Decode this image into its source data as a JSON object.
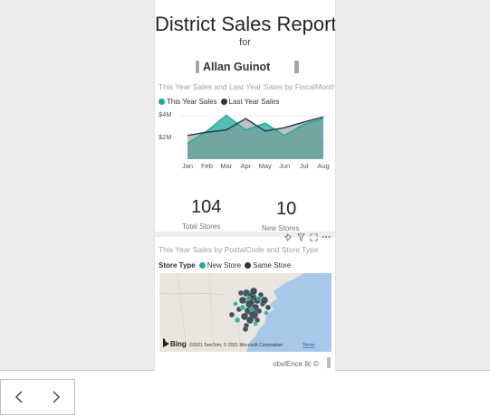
{
  "report": {
    "title": "District Sales Report",
    "subtitle": "for",
    "slicer_value": "Allan Guinot"
  },
  "line_chart": {
    "title": "This Year Sales and Last Year Sales by FiscalMonth",
    "legend": [
      {
        "label": "This Year Sales",
        "color": "#1aab9b"
      },
      {
        "label": "Last Year Sales",
        "color": "#253746"
      }
    ]
  },
  "chart_data": {
    "type": "area",
    "title": "This Year Sales and Last Year Sales by FiscalMonth",
    "categories": [
      "Jan",
      "Feb",
      "Mar",
      "Apr",
      "May",
      "Jun",
      "Jul",
      "Aug"
    ],
    "y_ticks": [
      "$4M",
      "$2M"
    ],
    "ylim": [
      0,
      4.5
    ],
    "series": [
      {
        "name": "This Year Sales",
        "values": [
          1.4,
          2.5,
          3.9,
          2.6,
          3.2,
          2.1,
          3.1,
          3.6
        ],
        "color": "#1aab9b"
      },
      {
        "name": "Last Year Sales",
        "values": [
          2.1,
          2.4,
          2.6,
          3.6,
          2.5,
          2.8,
          3.3,
          3.75
        ],
        "color": "#253746"
      }
    ]
  },
  "cards": [
    {
      "value": "104",
      "label": "Total Stores"
    },
    {
      "value": "10",
      "label": "New Stores"
    }
  ],
  "map_visual": {
    "title": "This Year Sales by PostalCode and Store Type",
    "legend_label": "Store Type",
    "legend": [
      {
        "label": "New Store",
        "color": "#1aab9b"
      },
      {
        "label": "Same Store",
        "color": "#253746"
      }
    ],
    "bing_label": "Bing",
    "attribution": "©2021 TomTom, © 2021 Microsoft Corporation",
    "terms": "Terms"
  },
  "footer": "obviEnce llc ©",
  "colors": {
    "accent": "#1aab9b",
    "dark": "#253746"
  }
}
